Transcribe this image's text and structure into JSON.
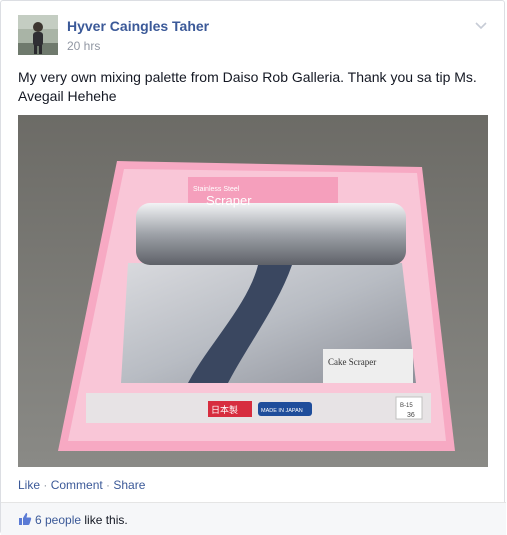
{
  "post": {
    "author": "Hyver Caingles Taher",
    "time": "20 hrs",
    "text": "My very own mixing palette from Daiso Rob Galleria. Thank you sa tip Ms. Avegail Hehehe"
  },
  "photo": {
    "package_title": "Stainless Steel",
    "package_name": "Scraper",
    "product_label": "Cake Scraper",
    "made_in_japan": "MADE IN JAPAN",
    "japan_kanji": "日本製",
    "item_code": "B-15",
    "item_number": "36"
  },
  "actions": {
    "like": "Like",
    "comment": "Comment",
    "share": "Share",
    "sep": " · "
  },
  "likes": {
    "count_text": "6 people",
    "suffix": " like this."
  },
  "icons": {
    "chevron": "chevron-down-icon",
    "thumb": "thumbs-up-icon"
  },
  "colors": {
    "link": "#3b5998",
    "meta": "#9197a3"
  }
}
